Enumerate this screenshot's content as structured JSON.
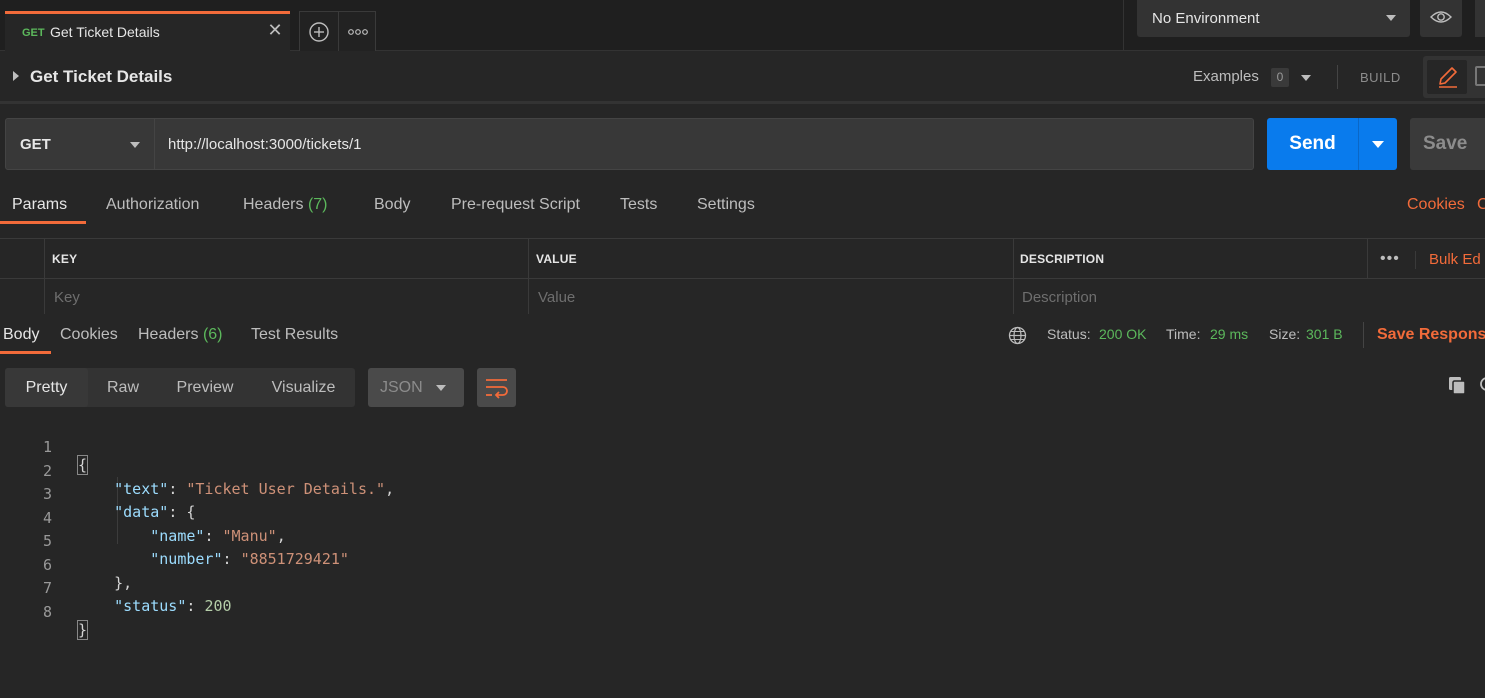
{
  "tabbar": {
    "active_tab": {
      "method": "GET",
      "title": "Get Ticket Details"
    },
    "environment": "No Environment"
  },
  "request": {
    "name": "Get Ticket Details",
    "examples_label": "Examples",
    "examples_count": "0",
    "build_label": "BUILD",
    "method": "GET",
    "url": "http://localhost:3000/tickets/1",
    "send_label": "Send",
    "save_label": "Save"
  },
  "request_tabs": {
    "params": "Params",
    "authorization": "Authorization",
    "headers": "Headers",
    "headers_count": "(7)",
    "body": "Body",
    "pre_request": "Pre-request Script",
    "tests": "Tests",
    "settings": "Settings",
    "cookies": "Cookies",
    "code": "C"
  },
  "params_table": {
    "columns": [
      "KEY",
      "VALUE",
      "DESCRIPTION"
    ],
    "placeholders": [
      "Key",
      "Value",
      "Description"
    ],
    "bulk_edit": "Bulk Ed"
  },
  "response_tabs": {
    "body": "Body",
    "cookies": "Cookies",
    "headers": "Headers",
    "headers_count": "(6)",
    "test_results": "Test Results"
  },
  "response_meta": {
    "status_label": "Status:",
    "status_value": "200 OK",
    "time_label": "Time:",
    "time_value": "29 ms",
    "size_label": "Size:",
    "size_value": "301 B",
    "save_response": "Save Response"
  },
  "body_toolbar": {
    "views": [
      "Pretty",
      "Raw",
      "Preview",
      "Visualize"
    ],
    "active_view": "Pretty",
    "format": "JSON"
  },
  "response_body": {
    "line_numbers": [
      "1",
      "2",
      "3",
      "4",
      "5",
      "6",
      "7",
      "8"
    ],
    "text_key": "\"text\"",
    "text_value": "\"Ticket User Details.\"",
    "data_key": "\"data\"",
    "name_key": "\"name\"",
    "name_value": "\"Manu\"",
    "number_key": "\"number\"",
    "number_value": "\"8851729421\"",
    "status_key": "\"status\"",
    "status_value": "200"
  },
  "colors": {
    "accent": "#f26b3a",
    "send_button": "#097bed",
    "success": "#5cb85c",
    "json_key": "#9cdcfe",
    "json_string": "#ce9178",
    "json_number": "#b5cea8"
  }
}
